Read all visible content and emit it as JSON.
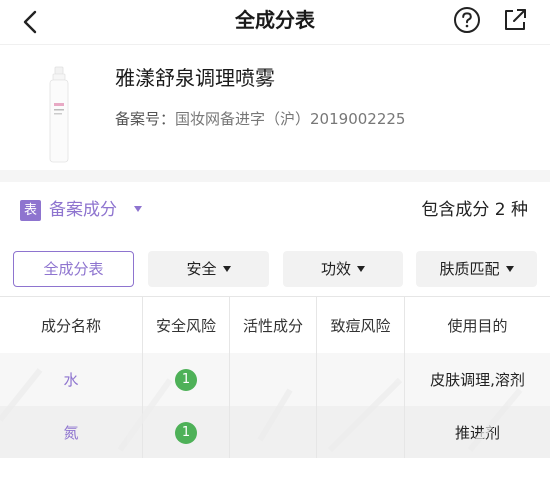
{
  "nav": {
    "title": "全成分表",
    "back_icon": "chevron-left-icon",
    "help_icon": "question-circle-icon",
    "share_icon": "share-icon"
  },
  "product": {
    "name": "雅漾舒泉调理喷雾",
    "registration_label": "备案号：",
    "registration_value": "国妆网备进字（沪）2019002225"
  },
  "filing": {
    "badge": "表",
    "label": "备案成分",
    "count_text": "包含成分 2 种"
  },
  "filters": {
    "all": "全成分表",
    "safety": "安全",
    "effect": "功效",
    "skin": "肤质匹配"
  },
  "table": {
    "headers": [
      "成分名称",
      "安全风险",
      "活性成分",
      "致痘风险",
      "使用目的"
    ],
    "rows": [
      {
        "name": "水",
        "risk": "1",
        "active": "",
        "acne": "",
        "purpose": "皮肤调理,溶剂"
      },
      {
        "name": "氮",
        "risk": "1",
        "active": "",
        "acne": "",
        "purpose": "推进剂"
      }
    ]
  },
  "colors": {
    "accent": "#8e74cf",
    "safe_green": "#4eb158",
    "text": "#222222"
  }
}
